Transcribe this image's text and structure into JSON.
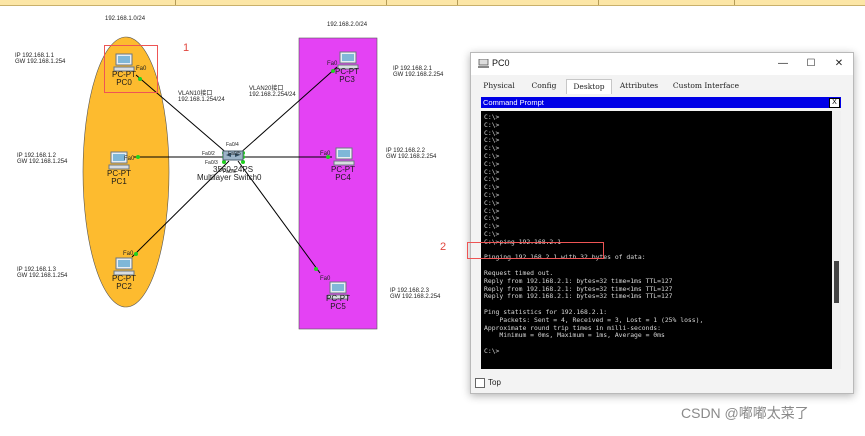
{
  "topbar": {},
  "network": {
    "subnet_left": "192.168.1.0/24",
    "subnet_right": "192.168.2.0/24",
    "markers": {
      "one": "1",
      "two": "2"
    },
    "pcs": [
      {
        "name": "PC-PT",
        "id": "PC0",
        "port": "Fa0",
        "ip": "IP 192.168.1.1",
        "gw": "GW 192.168.1.254"
      },
      {
        "name": "PC-PT",
        "id": "PC1",
        "port": "Fa0",
        "ip": "IP 192.168.1.2",
        "gw": "GW 192.168.1.254"
      },
      {
        "name": "PC-PT",
        "id": "PC2",
        "port": "Fa0",
        "ip": "IP 192.168.1.3",
        "gw": "GW 192.168.1.254"
      },
      {
        "name": "PC-PT",
        "id": "PC3",
        "port": "Fa0",
        "ip": "IP 192.168.2.1",
        "gw": "GW 192.168.2.254"
      },
      {
        "name": "PC-PT",
        "id": "PC4",
        "port": "Fa0",
        "ip": "IP 192.168.2.2",
        "gw": "GW 192.168.2.254"
      },
      {
        "name": "PC-PT",
        "id": "PC5",
        "port": "Fa0",
        "ip": "IP 192.168.2.3",
        "gw": "GW 192.168.2.254"
      }
    ],
    "switch": {
      "model": "3560-24PS",
      "name": "Multilayer Switch0"
    },
    "switch_ports": [
      "Fa0/1",
      "Fa0/2",
      "Fa0/3",
      "Fa0/4",
      "Fa0/5",
      "Fa0/6"
    ],
    "vlan10": {
      "title": "VLAN10接口",
      "ip": "192.168.1.254/24"
    },
    "vlan20": {
      "title": "VLAN20接口",
      "ip": "192.168.2.254/24"
    },
    "colors": {
      "vlan10": "#fdbb2f",
      "vlan20": "#e442f4",
      "link": "#000000"
    }
  },
  "window": {
    "title": "PC0",
    "controls": {
      "minimize": "—",
      "maximize": "☐",
      "close": "✕"
    },
    "tabs": [
      "Physical",
      "Config",
      "Desktop",
      "Attributes",
      "Custom Interface"
    ],
    "active_tab": "Desktop",
    "cmd_title": "Command Prompt",
    "cmd_close": "X",
    "terminal_lines": [
      "C:\\>",
      "C:\\>",
      "C:\\>",
      "C:\\>",
      "C:\\>",
      "C:\\>",
      "C:\\>",
      "C:\\>",
      "C:\\>",
      "C:\\>",
      "C:\\>",
      "C:\\>",
      "C:\\>",
      "C:\\>",
      "C:\\>",
      "C:\\>",
      "C:\\>ping 192.168.2.1",
      "",
      "Pinging 192.168.2.1 with 32 bytes of data:",
      "",
      "Request timed out.",
      "Reply from 192.168.2.1: bytes=32 time=1ms TTL=127",
      "Reply from 192.168.2.1: bytes=32 time<1ms TTL=127",
      "Reply from 192.168.2.1: bytes=32 time<1ms TTL=127",
      "",
      "Ping statistics for 192.168.2.1:",
      "    Packets: Sent = 4, Received = 3, Lost = 1 (25% loss),",
      "Approximate round trip times in milli-seconds:",
      "    Minimum = 0ms, Maximum = 1ms, Average = 0ms",
      "",
      "C:\\>"
    ],
    "top_checkbox": "Top"
  },
  "watermark": "CSDN @嘟嘟太菜了"
}
